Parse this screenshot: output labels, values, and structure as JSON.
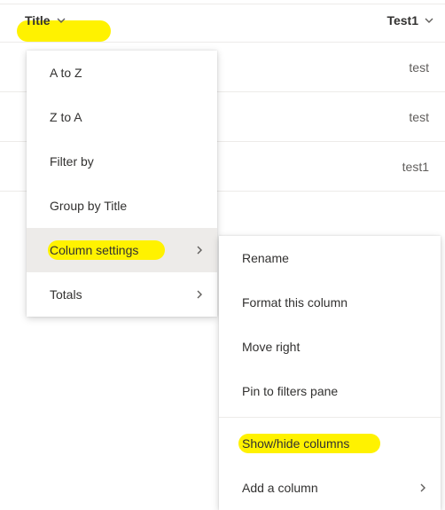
{
  "columns": {
    "title": {
      "label": "Title"
    },
    "test1": {
      "label": "Test1"
    }
  },
  "rows": [
    {
      "test1": "test"
    },
    {
      "test1": "test"
    },
    {
      "test1": "test1"
    },
    {
      "test1": ""
    }
  ],
  "menu": {
    "sort_asc": "A to Z",
    "sort_desc": "Z to A",
    "filter_by": "Filter by",
    "group_by": "Group by Title",
    "column_settings": "Column settings",
    "totals": "Totals"
  },
  "submenu": {
    "rename": "Rename",
    "format": "Format this column",
    "move_right": "Move right",
    "pin": "Pin to filters pane",
    "show_hide": "Show/hide columns",
    "add_column": "Add a column"
  }
}
